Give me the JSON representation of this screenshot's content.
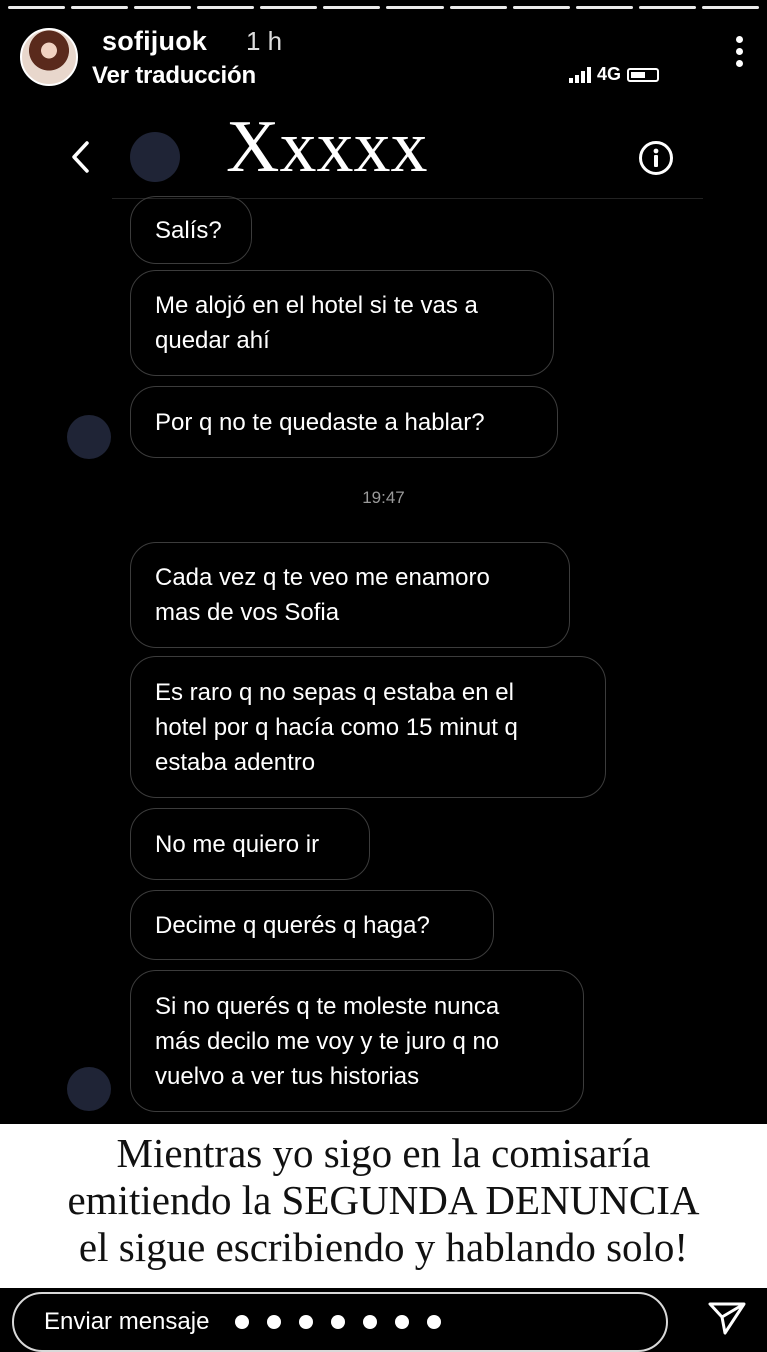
{
  "story": {
    "username": "sofijuok",
    "time": "1 h",
    "subline": "Ver traducción",
    "more_icon": "vertical-ellipsis-icon",
    "progress_segments": 12
  },
  "phone_status": {
    "network": "4G"
  },
  "dm": {
    "name": "Xxxxx",
    "back_icon": "chevron-left-icon",
    "info_icon": "info-icon"
  },
  "messages": [
    {
      "text": "Salís?"
    },
    {
      "text": "Me alojó en el hotel si te vas a\nquedar ahí"
    },
    {
      "text": "Por q no te quedaste a hablar?"
    },
    {
      "text": "Cada vez q te veo me enamoro\nmas de vos Sofia"
    },
    {
      "text": "Es raro q no sepas q estaba en el\nhotel por q hacía como 15 minut q\nestaba adentro"
    },
    {
      "text": "No me quiero ir"
    },
    {
      "text": "Decime q querés q haga?"
    },
    {
      "text": "Si no querés q te moleste nunca\nmás decilo me voy y te juro q no\nvuelvo a ver tus historias"
    }
  ],
  "timestamp": "19:47",
  "caption": {
    "line1": "Mientras yo sigo en la comisaría",
    "line2": "emitiendo la SEGUNDA DENUNCIA",
    "line3": "el sigue escribiendo y hablando solo!"
  },
  "reply": {
    "placeholder": "Enviar mensaje",
    "send_icon": "paper-plane-icon"
  },
  "colors": {
    "background": "#000000",
    "bubble_border": "#3c3c3c",
    "caption_bg": "#ffffff",
    "caption_text": "#111111"
  }
}
